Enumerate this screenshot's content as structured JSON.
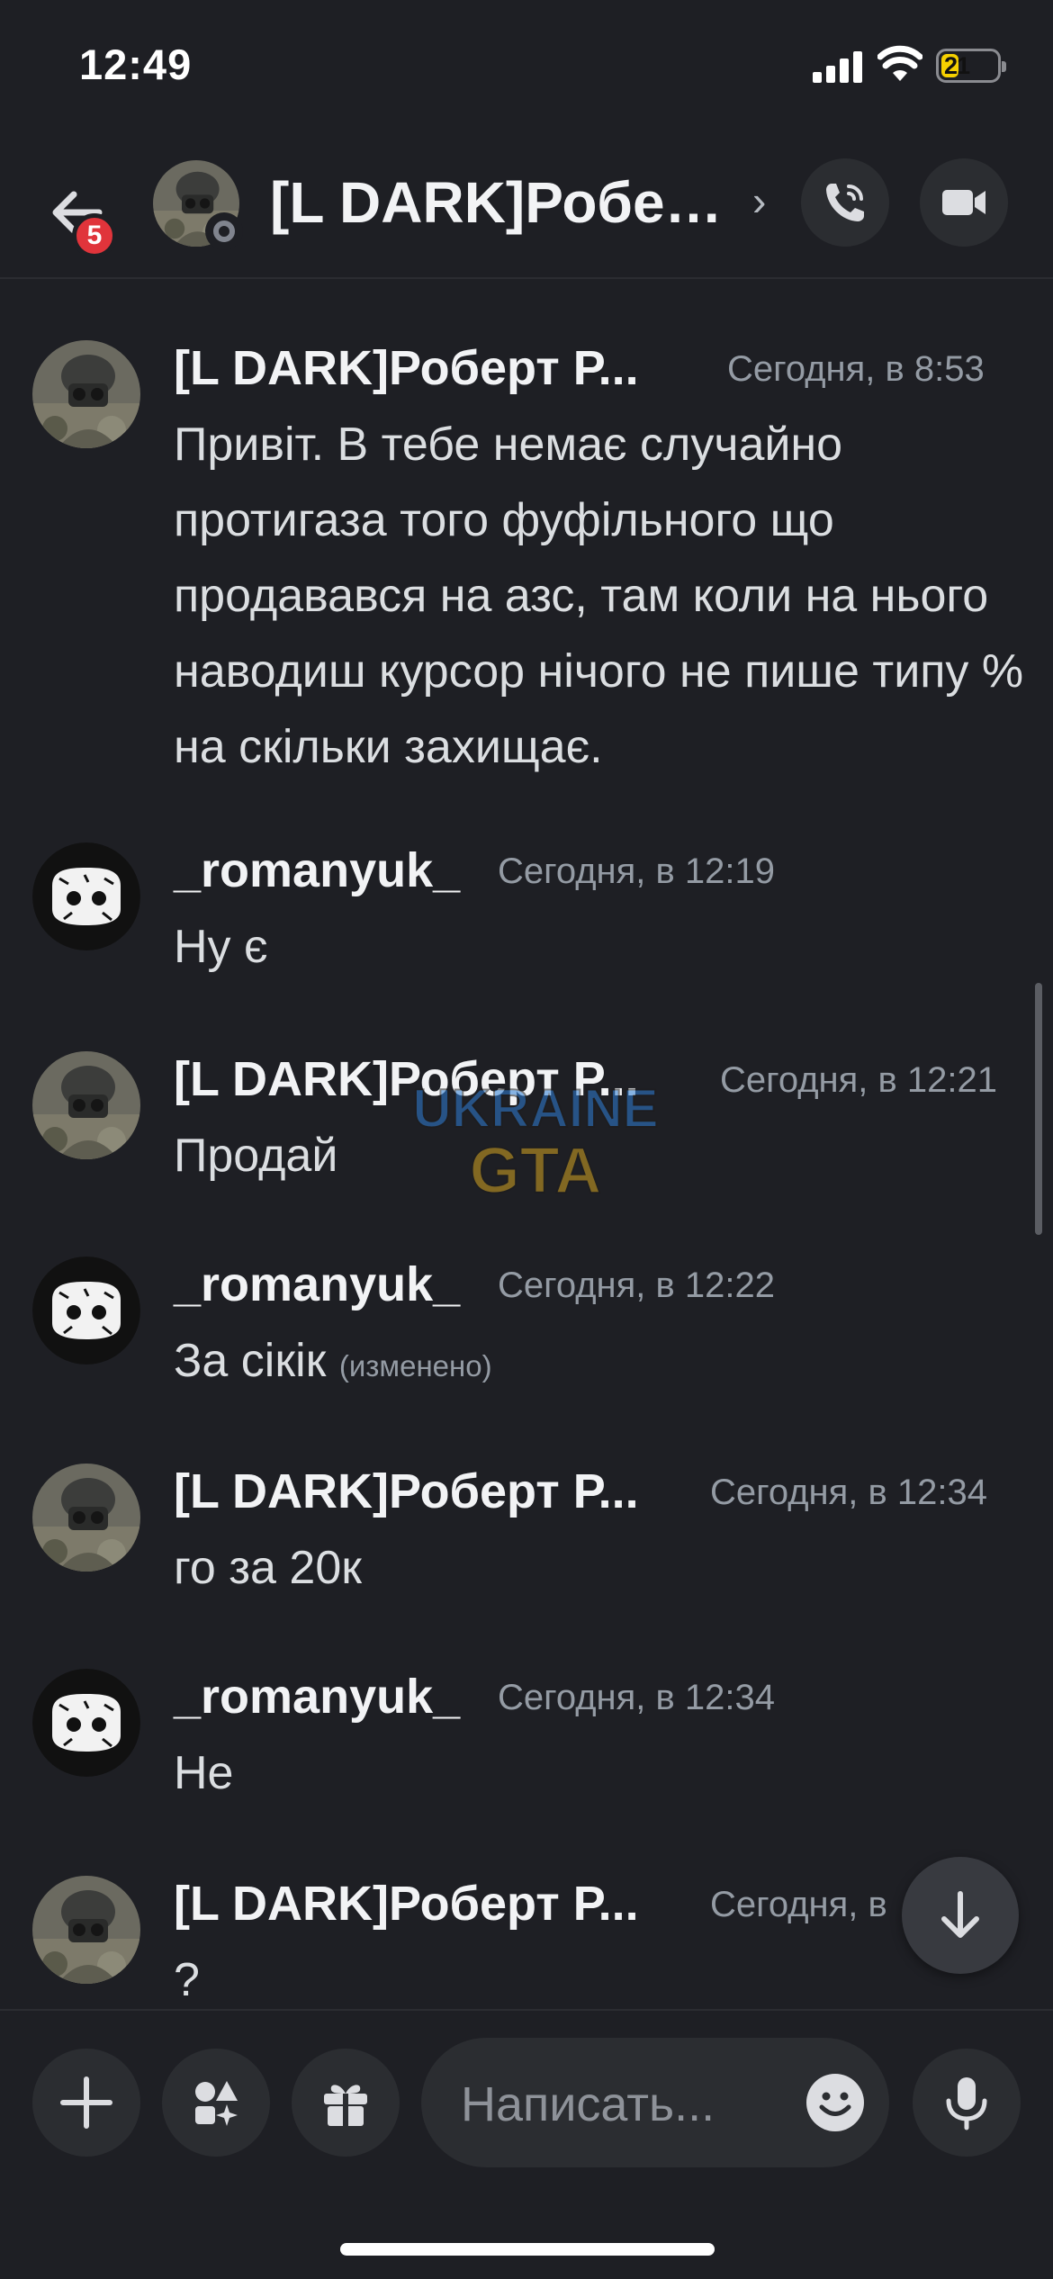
{
  "status_bar": {
    "time": "12:49",
    "battery": "21"
  },
  "header": {
    "back_badge": "5",
    "title": "[L DARK]Роберт Роберт",
    "chevron": "›",
    "icons": [
      "back-arrow-icon",
      "phone-icon",
      "video-camera-icon"
    ]
  },
  "messages": [
    {
      "author": "[L DARK]Роберт Р...",
      "time": "Сегодня, в 8:53",
      "text": "Привіт. В тебе немає случайно протигаза того фуфільного що продавався на азс, там коли на нього наводиш курсор нічого не пише типу % на скільки захищає."
    },
    {
      "author": "_romanyuk_",
      "time": "Сегодня, в 12:19",
      "text": "Ну є"
    },
    {
      "author": "[L DARK]Роберт Р...",
      "time": "Сегодня, в 12:21",
      "text": "Продай"
    },
    {
      "author": "_romanyuk_",
      "time": "Сегодня, в 12:22",
      "text": "За сікік",
      "edited": "(изменено)"
    },
    {
      "author": "[L DARK]Роберт Р...",
      "time": "Сегодня, в 12:34",
      "text": "го за 20к"
    },
    {
      "author": "_romanyuk_",
      "time": "Сегодня, в 12:34",
      "text": "Не"
    },
    {
      "author": "[L DARK]Роберт Р...",
      "time": "Сегодня, в",
      "text": "?"
    }
  ],
  "watermark": {
    "line1": "UKRAINE",
    "line2": "GTA"
  },
  "composer": {
    "placeholder": "Написать..."
  },
  "colors": {
    "background": "#1e1f24",
    "button": "#2b2d31",
    "badge": "#e0343b",
    "battery": "#f5d000"
  }
}
